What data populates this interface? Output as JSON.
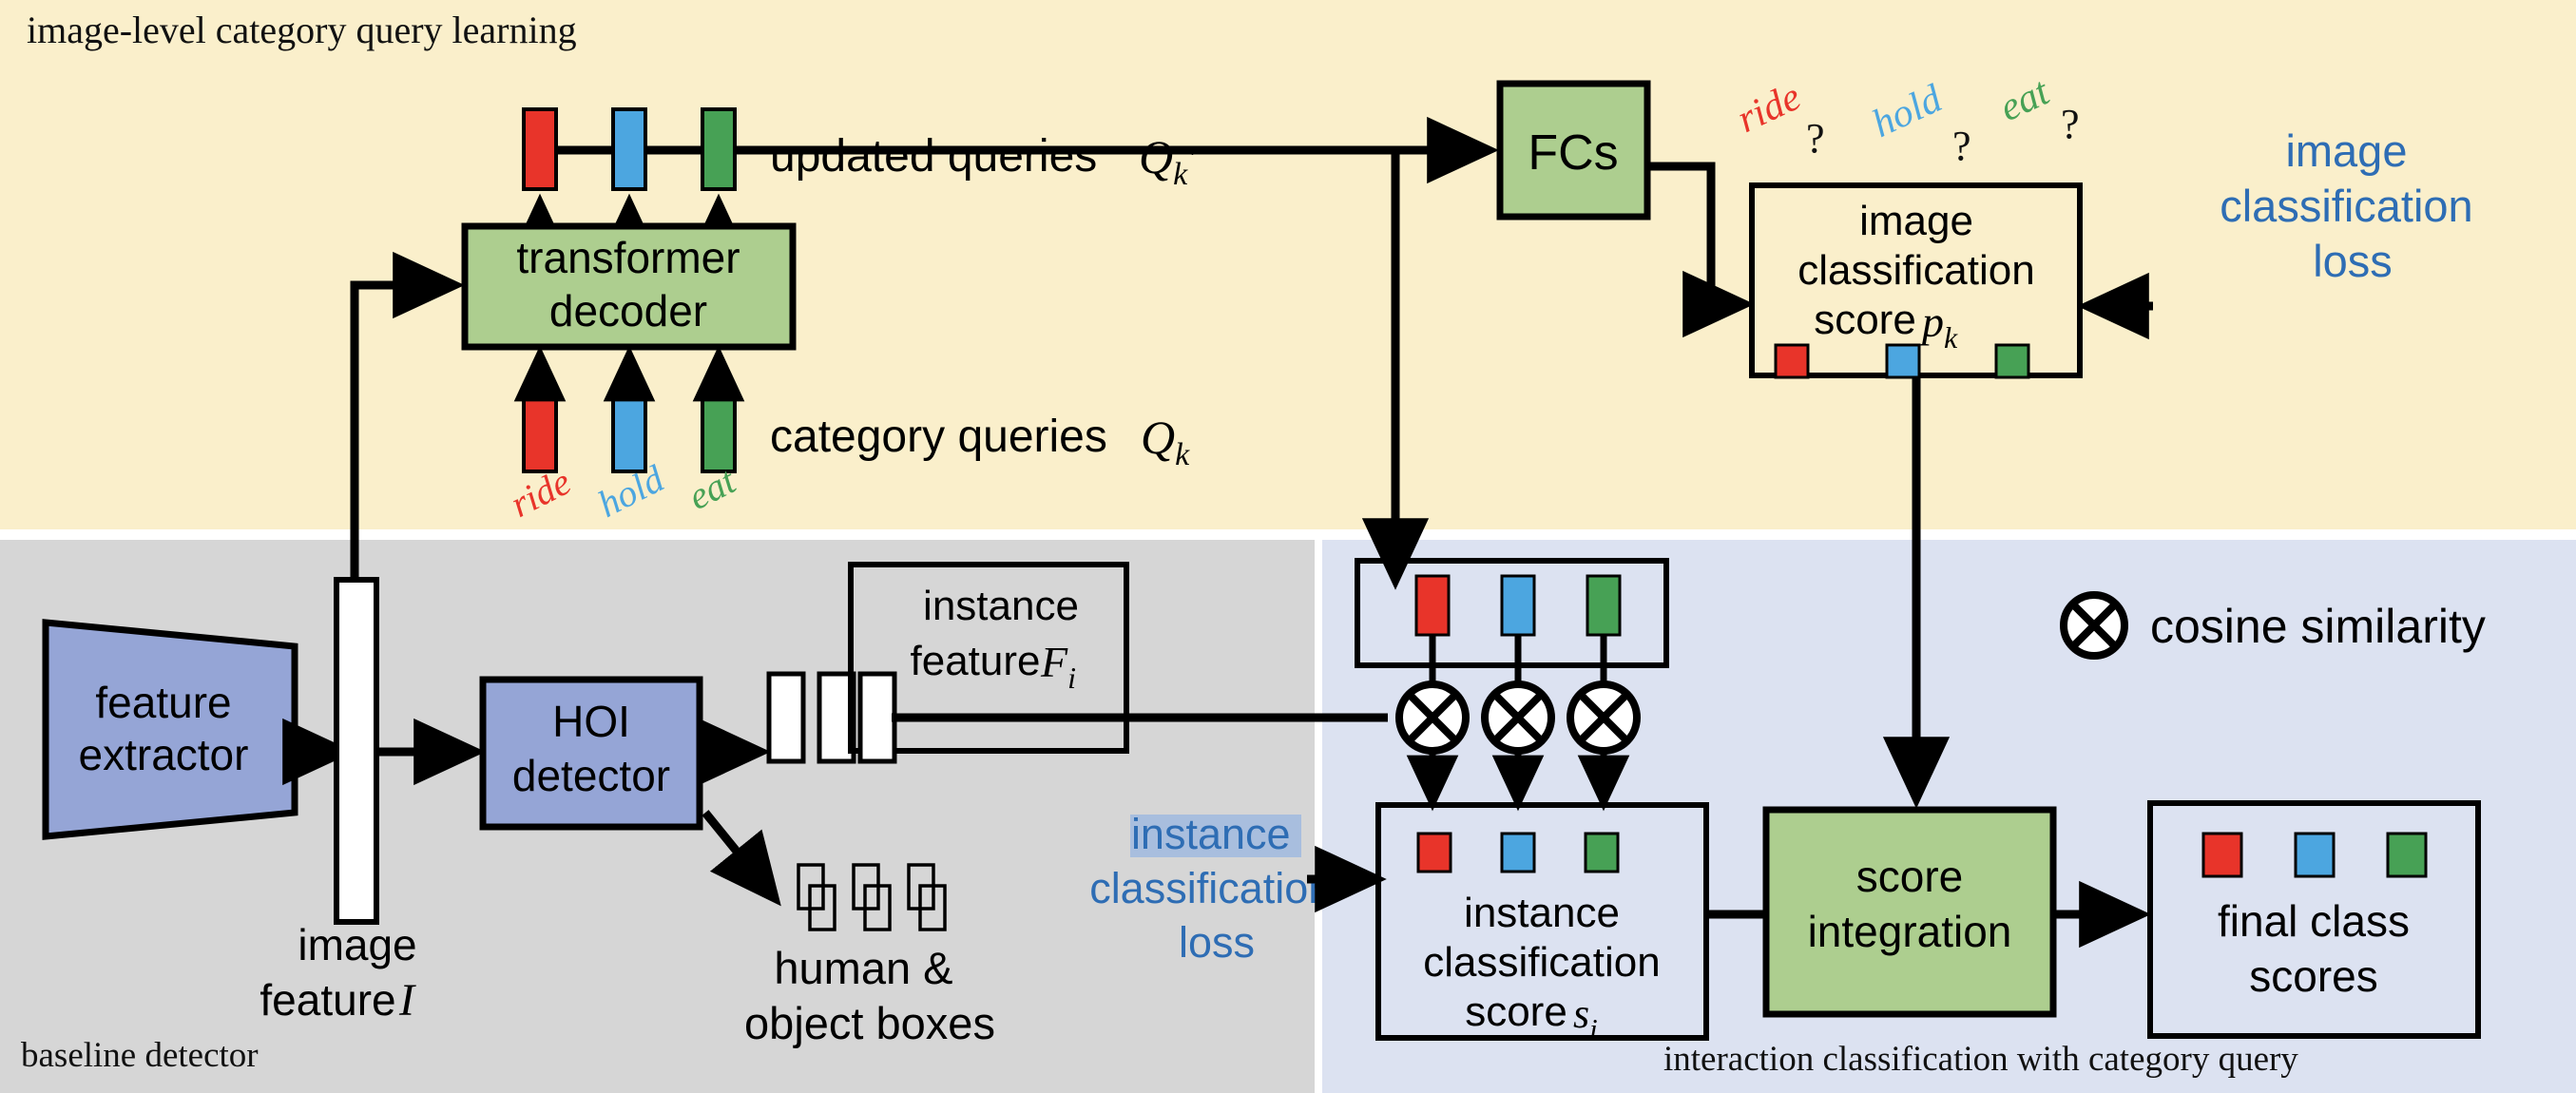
{
  "figure": {
    "type": "architecture-diagram",
    "panels": [
      {
        "id": "top",
        "title": "image-level category query learning",
        "bg": "#FAEFCB",
        "title_pos": "top-left"
      },
      {
        "id": "bottom-left",
        "title": "baseline detector",
        "bg": "#D6D6D6",
        "title_pos": "bottom-left"
      },
      {
        "id": "bottom-right",
        "title": "interaction classification with category query",
        "bg": "#DCE2F1",
        "title_pos": "bottom-right"
      }
    ]
  },
  "colors": {
    "red": "#E8342A",
    "blue": "#4CA6E0",
    "green": "#47A155",
    "green_box": "#ADCE8F",
    "blue_box": "#95A5D6",
    "panel_top": "#FAEFCB",
    "panel_bottom_left": "#D6D6D6",
    "panel_bottom_right": "#DCE2F1",
    "loss_text": "#2E6DB4",
    "highlight": "#A8BEDE",
    "stroke": "#000000"
  },
  "top_panel": {
    "title": "image-level category query learning",
    "transformer_decoder": {
      "line1": "transformer",
      "line2": "decoder"
    },
    "updated_queries_label": {
      "text": "updated queries",
      "symbol": "Q",
      "sub": "k",
      "prime": "′"
    },
    "category_queries_label": {
      "text": "category queries",
      "symbol": "Q",
      "sub": "k"
    },
    "query_tags": [
      {
        "label": "ride",
        "color": "#E8342A"
      },
      {
        "label": "hold",
        "color": "#4CA6E0"
      },
      {
        "label": "eat",
        "color": "#47A155"
      }
    ],
    "fcs_box": {
      "label": "FCs"
    },
    "question_tags": [
      {
        "word": "ride",
        "mark": "?",
        "color": "#E8342A"
      },
      {
        "word": "hold",
        "mark": "?",
        "color": "#4CA6E0"
      },
      {
        "word": "eat",
        "mark": "?",
        "color": "#47A155"
      }
    ],
    "image_classification_box": {
      "line1": "image",
      "line2": "classification",
      "line3": "score",
      "symbol": "p",
      "sub": "k"
    },
    "image_classification_loss": {
      "line1": "image",
      "line2": "classification",
      "line3": "loss"
    }
  },
  "bottom_left_panel": {
    "title": "baseline detector",
    "feature_extractor": {
      "line1": "feature",
      "line2": "extractor"
    },
    "image_feature_label": {
      "line1": "image",
      "line2": "feature",
      "symbol": "I"
    },
    "hoi_detector": {
      "line1": "HOI",
      "line2": "detector"
    },
    "instance_feature_box": {
      "line1": "instance",
      "line2": "feature",
      "symbol": "F",
      "sub": "i"
    },
    "boxes_label": {
      "line1": "human &",
      "line2": "object boxes"
    },
    "instance_classification_loss": {
      "line1": "instance",
      "line2": "classification",
      "line3": "loss"
    }
  },
  "bottom_right_panel": {
    "title": "interaction classification with category query",
    "legend": {
      "icon": "cosine-similarity-icon",
      "label": "cosine similarity"
    },
    "query_strip": {
      "name": "updated-query-strip"
    },
    "instance_classification_score_box": {
      "line1": "instance",
      "line2": "classification",
      "line3": "score",
      "symbol": "s",
      "sub": "i"
    },
    "score_integration_box": {
      "line1": "score",
      "line2": "integration"
    },
    "final_class_scores_box": {
      "line1": "final class",
      "line2": "scores"
    },
    "operators": [
      {
        "glyph": "⊗"
      },
      {
        "glyph": "⊗"
      },
      {
        "glyph": "⊗"
      }
    ]
  }
}
